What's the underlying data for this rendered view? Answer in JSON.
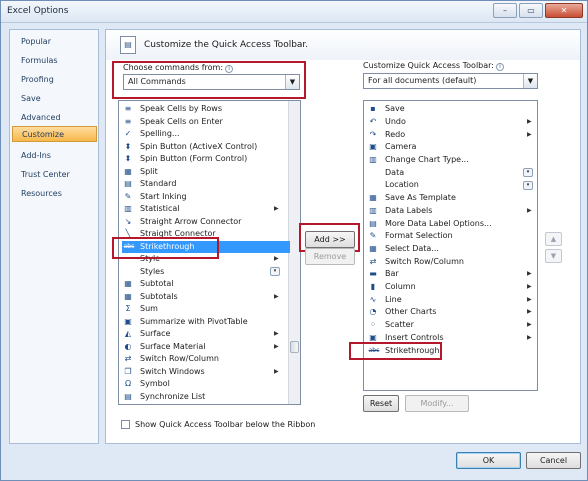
{
  "window": {
    "title": "Excel Options",
    "minimize_glyph": "–",
    "maximize_glyph": "▭",
    "close_glyph": "✕"
  },
  "nav": {
    "items": [
      {
        "label": "Popular"
      },
      {
        "label": "Formulas"
      },
      {
        "label": "Proofing"
      },
      {
        "label": "Save"
      },
      {
        "label": "Advanced"
      },
      {
        "label": "Customize",
        "active": true
      },
      {
        "label": "Add-Ins"
      },
      {
        "label": "Trust Center"
      },
      {
        "label": "Resources"
      }
    ]
  },
  "header": {
    "title": "Customize the Quick Access Toolbar.",
    "icon": "qat-icon"
  },
  "left": {
    "label": "Choose commands from:",
    "info_glyph": "i",
    "combo_value": "All Commands",
    "arrow_glyph": "▼",
    "items": [
      {
        "label": "Speak Cells by Rows",
        "icon": "speak-icon",
        "glyph": "≡"
      },
      {
        "label": "Speak Cells on Enter",
        "icon": "speak-icon",
        "glyph": "≡"
      },
      {
        "label": "Spelling...",
        "icon": "spelling-icon",
        "glyph": "✓"
      },
      {
        "label": "Spin Button (ActiveX Control)",
        "icon": "spin-icon",
        "glyph": "⬍"
      },
      {
        "label": "Spin Button (Form Control)",
        "icon": "spin-icon",
        "glyph": "⬍"
      },
      {
        "label": "Split",
        "icon": "split-icon",
        "glyph": "▦"
      },
      {
        "label": "Standard",
        "icon": "standard-icon",
        "glyph": "▤"
      },
      {
        "label": "Start Inking",
        "icon": "pen-icon",
        "glyph": "✎"
      },
      {
        "label": "Statistical",
        "icon": "book-icon",
        "glyph": "▥",
        "submenu": true
      },
      {
        "label": "Straight Arrow Connector",
        "icon": "arrow-line-icon",
        "glyph": "↘"
      },
      {
        "label": "Straight Connector",
        "icon": "line-icon",
        "glyph": "╲"
      },
      {
        "label": "Strikethrough",
        "icon": "strikethrough-icon",
        "glyph": "abc",
        "selected": true
      },
      {
        "label": "Style",
        "icon": "blank-icon",
        "glyph": "",
        "submenu": true
      },
      {
        "label": "Styles",
        "icon": "blank-icon",
        "glyph": "",
        "dropdown": true
      },
      {
        "label": "Subtotal",
        "icon": "subtotal-icon",
        "glyph": "▦"
      },
      {
        "label": "Subtotals",
        "icon": "subtotal-icon",
        "glyph": "▦",
        "submenu": true
      },
      {
        "label": "Sum",
        "icon": "sum-icon",
        "glyph": "Σ"
      },
      {
        "label": "Summarize with PivotTable",
        "icon": "pivot-icon",
        "glyph": "▣"
      },
      {
        "label": "Surface",
        "icon": "chart-icon",
        "glyph": "◭",
        "submenu": true
      },
      {
        "label": "Surface Material",
        "icon": "material-icon",
        "glyph": "◐",
        "submenu": true
      },
      {
        "label": "Switch Row/Column",
        "icon": "switch-icon",
        "glyph": "⇄"
      },
      {
        "label": "Switch Windows",
        "icon": "window-icon",
        "glyph": "❐",
        "submenu": true
      },
      {
        "label": "Symbol",
        "icon": "omega-icon",
        "glyph": "Ω"
      },
      {
        "label": "Synchronize List",
        "icon": "list-icon",
        "glyph": "▤"
      }
    ],
    "scroll_up_glyph": "▲",
    "scroll_down_glyph": "▼"
  },
  "mid": {
    "add_label": "Add >>",
    "remove_label": "Remove"
  },
  "right": {
    "label": "Customize Quick Access Toolbar:",
    "info_glyph": "i",
    "combo_value": "For all documents (default)",
    "arrow_glyph": "▼",
    "items": [
      {
        "label": "Save",
        "icon": "save-icon",
        "glyph": "▪"
      },
      {
        "label": "Undo",
        "icon": "undo-icon",
        "glyph": "↶",
        "submenu": true
      },
      {
        "label": "Redo",
        "icon": "redo-icon",
        "glyph": "↷",
        "submenu": true
      },
      {
        "label": "Camera",
        "icon": "camera-icon",
        "glyph": "▣"
      },
      {
        "label": "Change Chart Type...",
        "icon": "chart-icon",
        "glyph": "▥"
      },
      {
        "label": "Data",
        "icon": "blank-icon",
        "glyph": "",
        "dropdown": true
      },
      {
        "label": "Location",
        "icon": "blank-icon",
        "glyph": "",
        "dropdown": true
      },
      {
        "label": "Save As Template",
        "icon": "template-icon",
        "glyph": "▦"
      },
      {
        "label": "Data Labels",
        "icon": "datalabels-icon",
        "glyph": "▥",
        "submenu": true
      },
      {
        "label": "More Data Label Options...",
        "icon": "options-icon",
        "glyph": "▤"
      },
      {
        "label": "Format Selection",
        "icon": "format-icon",
        "glyph": "✎"
      },
      {
        "label": "Select Data...",
        "icon": "select-data-icon",
        "glyph": "▦"
      },
      {
        "label": "Switch Row/Column",
        "icon": "switch-icon",
        "glyph": "⇄"
      },
      {
        "label": "Bar",
        "icon": "bar-chart-icon",
        "glyph": "▬",
        "submenu": true
      },
      {
        "label": "Column",
        "icon": "column-chart-icon",
        "glyph": "▮",
        "submenu": true
      },
      {
        "label": "Line",
        "icon": "line-chart-icon",
        "glyph": "∿",
        "submenu": true
      },
      {
        "label": "Other Charts",
        "icon": "pie-icon",
        "glyph": "◔",
        "submenu": true
      },
      {
        "label": "Scatter",
        "icon": "scatter-icon",
        "glyph": "⁘",
        "submenu": true
      },
      {
        "label": "Insert Controls",
        "icon": "controls-icon",
        "glyph": "▣",
        "submenu": true
      },
      {
        "label": "Strikethrough",
        "icon": "strikethrough-icon",
        "glyph": "abc"
      }
    ],
    "reset_label": "Reset",
    "modify_label": "Modify...",
    "move_up_glyph": "▲",
    "move_down_glyph": "▼",
    "submenu_glyph": "▶",
    "dropdown_glyph": "▾"
  },
  "bottom": {
    "checkbox_label": "Show Quick Access Toolbar below the Ribbon",
    "ok_label": "OK",
    "cancel_label": "Cancel"
  }
}
